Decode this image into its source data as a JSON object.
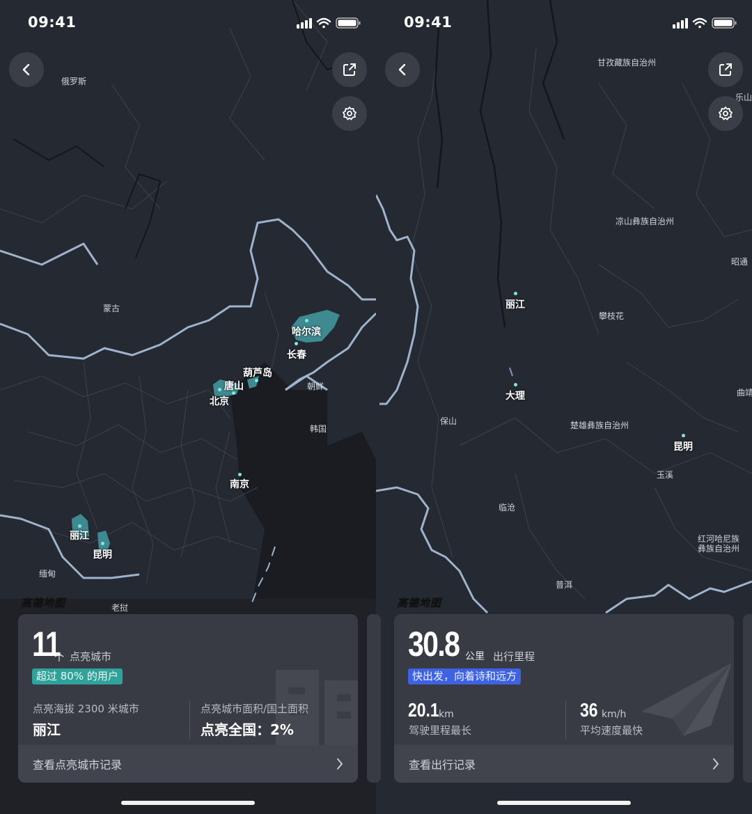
{
  "status_bar": {
    "time": "09:41"
  },
  "left": {
    "map_labels": {
      "russia": "俄罗斯",
      "mongolia": "蒙古",
      "north_korea": "朝鲜",
      "south_korea": "韩国",
      "myanmar": "缅甸",
      "laos": "老挝"
    },
    "cities": {
      "harbin": "哈尔滨",
      "changchun": "长春",
      "huludao": "葫芦岛",
      "tangshan": "唐山",
      "beijing": "北京",
      "nanjing": "南京",
      "lijiang": "丽江",
      "kunming": "昆明"
    },
    "watermark": "高德地图",
    "card": {
      "count": "11",
      "count_unit": "个",
      "count_desc": "点亮城市",
      "badge": "超过 80% 的用户",
      "stat1_label": "点亮海拔 2300 米城市",
      "stat1_value": "丽江",
      "stat2_label": "点亮城市面积/国土面积",
      "stat2_value": "点亮全国：2%",
      "footer": "查看点亮城市记录"
    }
  },
  "right": {
    "map_labels": {
      "ganzi": "甘孜藏族自治州",
      "leshan": "乐山",
      "liangshan": "凉山彝族自治州",
      "zhaotong": "昭通",
      "panzhihua": "攀枝花",
      "qujing": "曲靖",
      "baoshan": "保山",
      "chuxiong": "楚雄彝族自治州",
      "yuxi": "玉溪",
      "lincang": "临沧",
      "honghe_1": "红河哈尼族",
      "honghe_2": "彝族自治州",
      "puer": "普洱"
    },
    "cities": {
      "lijiang": "丽江",
      "dali": "大理",
      "kunming": "昆明"
    },
    "watermark": "高德地图",
    "card": {
      "distance": "30.8",
      "distance_unit": "公里",
      "distance_desc": "出行里程",
      "badge": "快出发，向着诗和远方",
      "stat1_value": "20.1",
      "stat1_unit": "km",
      "stat1_label": "驾驶里程最长",
      "stat2_value": "36",
      "stat2_unit": "km/h",
      "stat2_label": "平均速度最快",
      "footer": "查看出行记录"
    }
  },
  "colors": {
    "map_bg": "#252932",
    "border": "#9fb3cc",
    "teal_region": "#3f8a91",
    "badge_teal": "#2fa29a",
    "badge_blue": "#3f63e0",
    "card_bg": "#383b43"
  },
  "icons": [
    "signal-icon",
    "wifi-icon",
    "battery-icon",
    "back-arrow-icon",
    "share-icon",
    "settings-gear-icon",
    "chevron-right-icon"
  ]
}
